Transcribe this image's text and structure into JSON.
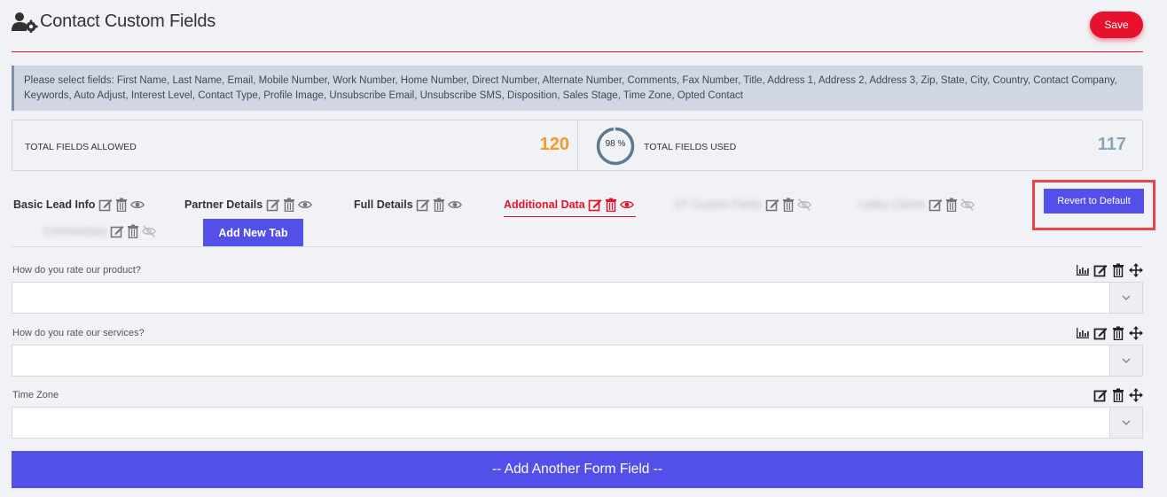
{
  "header": {
    "title": "Contact Custom Fields",
    "save_label": "Save"
  },
  "notice": {
    "text": "Please select fields: First Name, Last Name, Email, Mobile Number, Work Number, Home Number, Direct Number, Alternate Number, Comments, Fax Number, Title, Address 1, Address 2, Address 3, Zip, State, City, Country, Contact Company, Keywords, Auto Adjust, Interest Level, Contact Type, Profile Image, Unsubscribe Email, Unsubscribe SMS, Disposition, Sales Stage, Time Zone, Opted Contact"
  },
  "stats": {
    "allowed_label": "TOTAL FIELDS ALLOWED",
    "allowed_value": "120",
    "used_label": "TOTAL FIELDS USED",
    "used_value": "117",
    "used_percent_text": "98 %",
    "used_fraction": 0.98
  },
  "tabs": [
    {
      "label": "Basic Lead Info",
      "state": "visible"
    },
    {
      "label": "Partner Details",
      "state": "visible"
    },
    {
      "label": "Full Details",
      "state": "visible"
    },
    {
      "label": "Additional Data",
      "state": "active"
    },
    {
      "label": "ST Custom Fields",
      "state": "hidden"
    },
    {
      "label": "Lobby Clients",
      "state": "hidden"
    },
    {
      "label": "Commentary",
      "state": "hidden"
    }
  ],
  "add_tab_label": "Add New Tab",
  "revert_label": "Revert to Default",
  "fields": [
    {
      "label": "How do you rate our product?",
      "value": ""
    },
    {
      "label": "How do you rate our services?",
      "value": ""
    },
    {
      "label": "Time Zone",
      "value": ""
    }
  ],
  "add_field_label": "-- Add Another Form Field --",
  "colors": {
    "accent_red": "#e8112d",
    "primary_purple": "#5350e9",
    "allowed_orange": "#f59a23",
    "used_blue": "#8aa4b8"
  }
}
